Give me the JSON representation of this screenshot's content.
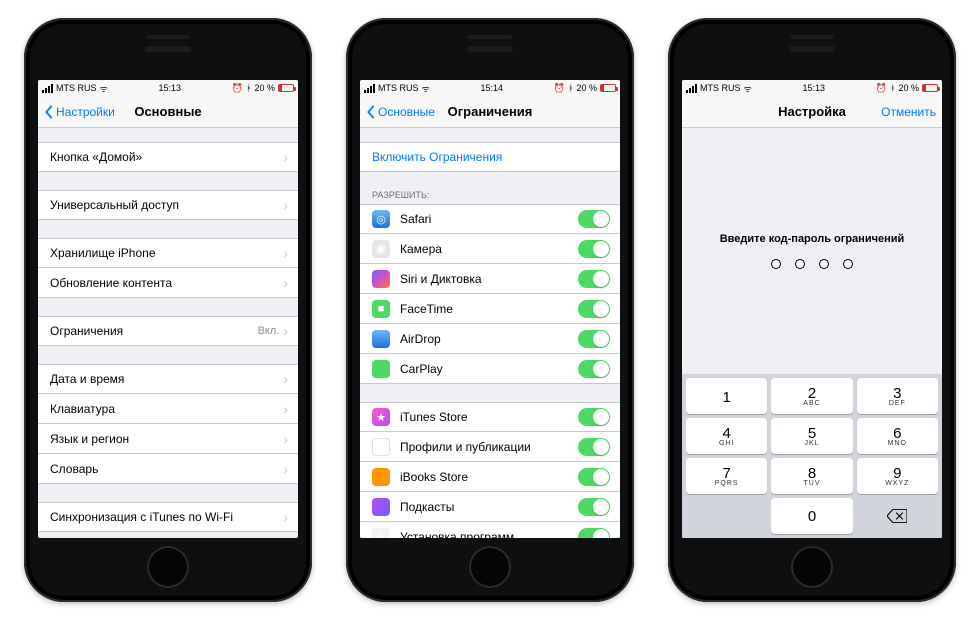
{
  "status": {
    "carrier": "MTS RUS",
    "wifi_glyph": "▴",
    "time1": "15:13",
    "time2": "15:14",
    "time3": "15:13",
    "alarm_glyph": "⏰",
    "bt_glyph": "\"",
    "battery_pct": "20 %"
  },
  "phone1": {
    "nav_back": "Настройки",
    "nav_title": "Основные",
    "groups": [
      {
        "rows": [
          {
            "label": "Кнопка «Домой»"
          }
        ]
      },
      {
        "rows": [
          {
            "label": "Универсальный доступ"
          }
        ]
      },
      {
        "rows": [
          {
            "label": "Хранилище iPhone"
          },
          {
            "label": "Обновление контента"
          }
        ]
      },
      {
        "rows": [
          {
            "label": "Ограничения",
            "value": "Вкл."
          }
        ]
      },
      {
        "rows": [
          {
            "label": "Дата и время"
          },
          {
            "label": "Клавиатура"
          },
          {
            "label": "Язык и регион"
          },
          {
            "label": "Словарь"
          }
        ]
      },
      {
        "rows": [
          {
            "label": "Синхронизация с iTunes по Wi-Fi"
          }
        ]
      }
    ]
  },
  "phone2": {
    "nav_back": "Основные",
    "nav_title": "Ограничения",
    "enable_label": "Включить Ограничения",
    "allow_header": "РАЗРЕШИТЬ:",
    "allow_group_a": [
      {
        "label": "Safari",
        "icon": "ic-safari",
        "glyph": "◎"
      },
      {
        "label": "Камера",
        "icon": "ic-camera",
        "glyph": "▣"
      },
      {
        "label": "Siri и Диктовка",
        "icon": "ic-siri",
        "glyph": ""
      },
      {
        "label": "FaceTime",
        "icon": "ic-facetime",
        "glyph": "■"
      },
      {
        "label": "AirDrop",
        "icon": "ic-airdrop",
        "glyph": ""
      },
      {
        "label": "CarPlay",
        "icon": "ic-carplay",
        "glyph": ""
      }
    ],
    "allow_group_b": [
      {
        "label": "iTunes Store",
        "icon": "ic-itunes",
        "glyph": "★"
      },
      {
        "label": "Профили и публикации",
        "icon": "ic-profiles",
        "glyph": "♪"
      },
      {
        "label": "iBooks Store",
        "icon": "ic-ibooks",
        "glyph": ""
      },
      {
        "label": "Подкасты",
        "icon": "ic-podcast",
        "glyph": ""
      },
      {
        "label": "Установка программ",
        "icon": "ic-install",
        "glyph": "A"
      }
    ]
  },
  "phone3": {
    "nav_title": "Настройка",
    "nav_action": "Отменить",
    "prompt": "Введите код-пароль ограничений",
    "keypad": [
      [
        {
          "d": "1",
          "s": ""
        },
        {
          "d": "2",
          "s": "ABC"
        },
        {
          "d": "3",
          "s": "DEF"
        }
      ],
      [
        {
          "d": "4",
          "s": "GHI"
        },
        {
          "d": "5",
          "s": "JKL"
        },
        {
          "d": "6",
          "s": "MNO"
        }
      ],
      [
        {
          "d": "7",
          "s": "PQRS"
        },
        {
          "d": "8",
          "s": "TUV"
        },
        {
          "d": "9",
          "s": "WXYZ"
        }
      ],
      [
        {
          "blank": true
        },
        {
          "d": "0",
          "s": ""
        },
        {
          "del": true
        }
      ]
    ]
  }
}
